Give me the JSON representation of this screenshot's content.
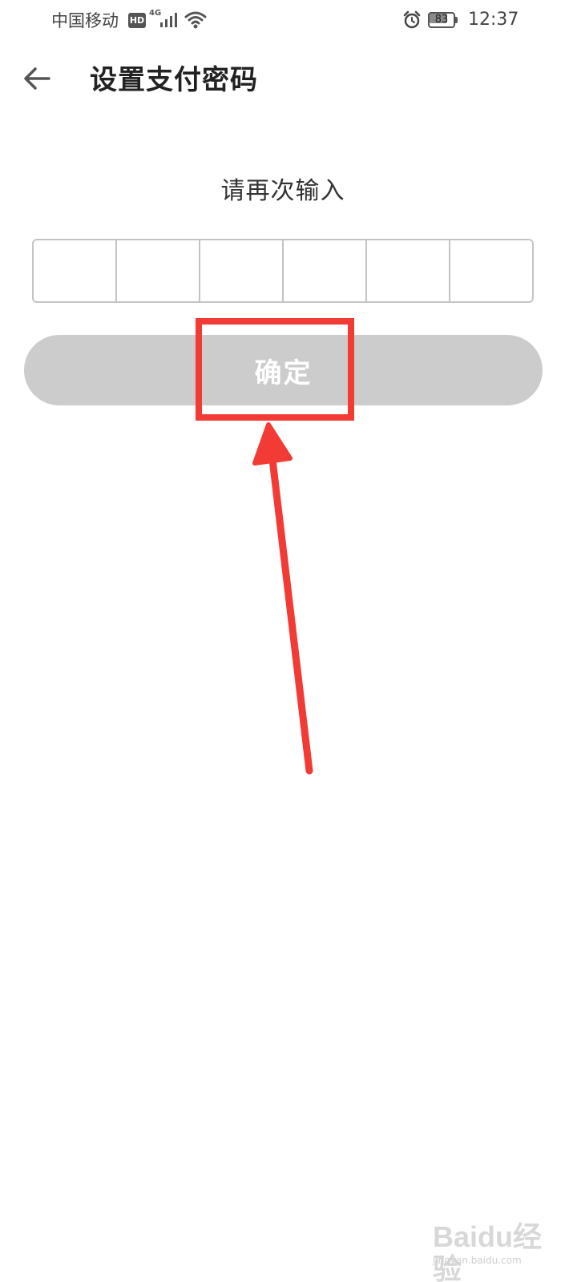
{
  "status_bar": {
    "carrier": "中国移动",
    "hd_label": "HD",
    "network_label": "4G",
    "battery_level": "83",
    "battery_fraction": 0.83,
    "time": "12:37",
    "icons": [
      "signal-icon",
      "wifi-icon",
      "alarm-icon",
      "battery-icon"
    ]
  },
  "header": {
    "back_icon": "arrow-left-icon",
    "title": "设置支付密码"
  },
  "main": {
    "prompt": "请再次输入",
    "pin_length": 6,
    "confirm_label": "确定"
  },
  "colors": {
    "button_disabled": "#cccccc",
    "annotation_red": "#f23b35",
    "box_border": "#c4c4c4"
  },
  "watermark": {
    "brand": "Baidu经验",
    "sub": "jingyan.baidu.com"
  }
}
